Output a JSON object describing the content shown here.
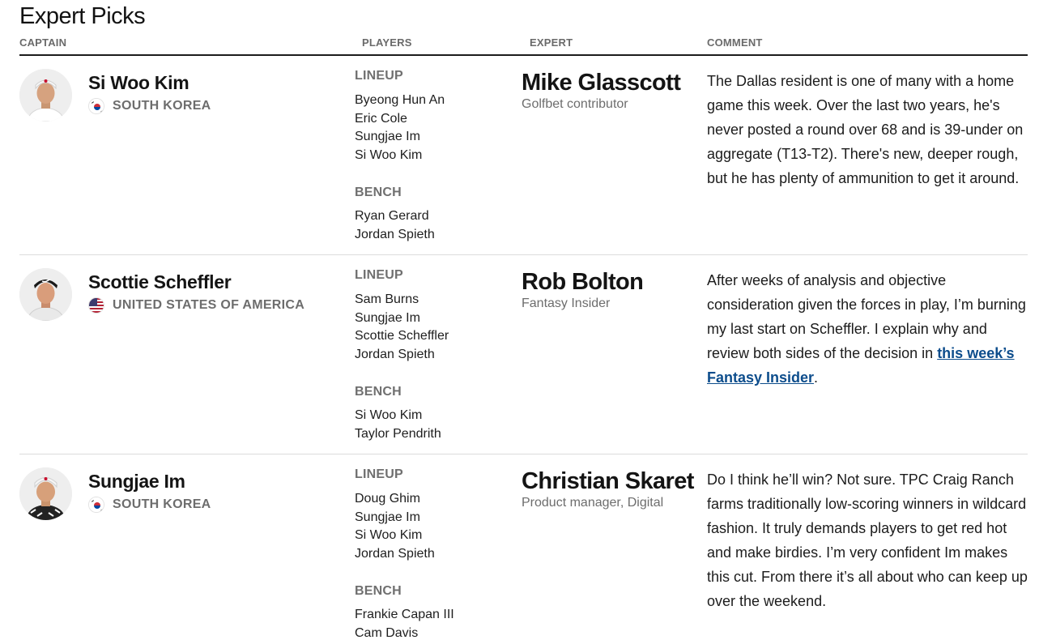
{
  "title": "Expert Picks",
  "columns": {
    "captain": "CAPTAIN",
    "players": "PLAYERS",
    "expert": "EXPERT",
    "comment": "COMMENT"
  },
  "lineup_label": "LINEUP",
  "bench_label": "BENCH",
  "rows": [
    {
      "captain": "Si Woo Kim",
      "country": "SOUTH KOREA",
      "flag": "south-korea-flag-icon",
      "lineup": [
        "Byeong Hun An",
        "Eric Cole",
        "Sungjae Im",
        "Si Woo Kim"
      ],
      "bench": [
        "Ryan Gerard",
        "Jordan Spieth"
      ],
      "expert": "Mike Glasscott",
      "role": "Golfbet contributor",
      "comment": "The Dallas resident is one of many with a home game this week. Over the last two years, he's never posted a round over 68 and is 39-under on aggregate (T13-T2). There's new, deeper rough, but he has plenty of ammunition to get it around."
    },
    {
      "captain": "Scottie Scheffler",
      "country": "UNITED STATES OF AMERICA",
      "flag": "usa-flag-icon",
      "lineup": [
        "Sam Burns",
        "Sungjae Im",
        "Scottie Scheffler",
        "Jordan Spieth"
      ],
      "bench": [
        "Si Woo Kim",
        "Taylor Pendrith"
      ],
      "expert": "Rob Bolton",
      "role": "Fantasy Insider",
      "comment": "After weeks of analysis and objective consideration given the forces in play, I’m burning my last start on Scheffler. I explain why and review both sides of the decision in",
      "comment_link": "this week’s Fantasy Insider",
      "comment_after": "."
    },
    {
      "captain": "Sungjae Im",
      "country": "SOUTH KOREA",
      "flag": "south-korea-flag-icon",
      "lineup": [
        "Doug Ghim",
        "Sungjae Im",
        "Si Woo Kim",
        "Jordan Spieth"
      ],
      "bench": [
        "Frankie Capan III",
        "Cam Davis"
      ],
      "expert": "Christian Skaret",
      "role": "Product manager, Digital",
      "comment": "Do I think he’ll win? Not sure. TPC Craig Ranch farms traditionally low-scoring winners in wildcard fashion. It truly demands players to get red hot and make birdies. I’m very confident Im makes this cut. From there it’s all about who can keep up over the weekend."
    }
  ],
  "colors": {
    "link": "#0d4d8c",
    "muted": "#6d6d6d",
    "divider": "#dcdcdc"
  }
}
